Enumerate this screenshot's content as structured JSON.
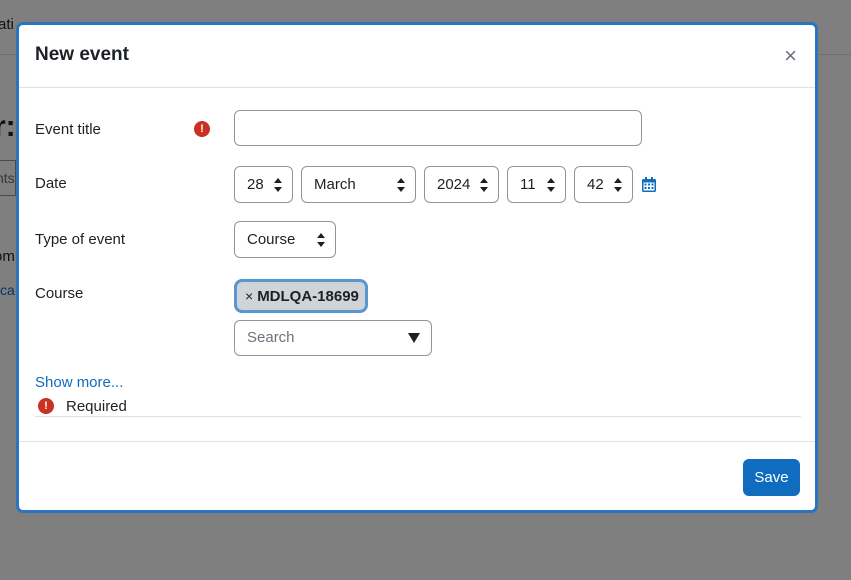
{
  "background": {
    "nav_fragment": "ati",
    "heading_fragment": "r:",
    "tab_fragment": "nts",
    "text_fragment_1": "om",
    "link_fragment": "ca"
  },
  "modal": {
    "title": "New event",
    "close_symbol": "×",
    "form": {
      "event_title": {
        "label": "Event title",
        "value": ""
      },
      "date": {
        "label": "Date",
        "day": "28",
        "month": "March",
        "year": "2024",
        "hour": "11",
        "minute": "42"
      },
      "type_of_event": {
        "label": "Type of event",
        "value": "Course"
      },
      "course": {
        "label": "Course",
        "selected_chip": "MDLQA-18699",
        "chip_remove_symbol": "×",
        "search_placeholder": "Search"
      }
    },
    "show_more": "Show more...",
    "required_note": "Required",
    "required_icon_symbol": "!",
    "save_label": "Save"
  },
  "colors": {
    "primary": "#0f6cbf",
    "required_icon": "#ca3120",
    "modal_border": "#2a74c0"
  }
}
